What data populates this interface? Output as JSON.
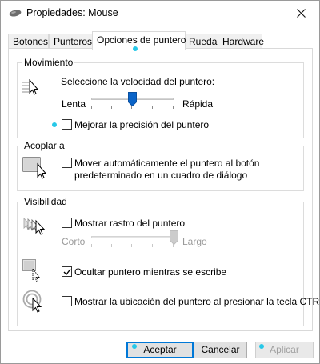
{
  "window": {
    "title": "Propiedades: Mouse"
  },
  "tabs": [
    {
      "label": "Botones"
    },
    {
      "label": "Punteros"
    },
    {
      "label": "Opciones de puntero"
    },
    {
      "label": "Rueda"
    },
    {
      "label": "Hardware"
    }
  ],
  "movement": {
    "group_title": "Movimiento",
    "speed_label": "Seleccione la velocidad del puntero:",
    "slow_label": "Lenta",
    "fast_label": "Rápida",
    "speed_level": 0.5,
    "precision_label": "Mejorar la precisión del puntero",
    "precision_checked": false
  },
  "snap": {
    "group_title": "Acoplar a",
    "line1": "Mover automáticamente el puntero al botón",
    "line2": "predeterminado en un cuadro de diálogo",
    "checked": false
  },
  "visibility": {
    "group_title": "Visibilidad",
    "trails_label": "Mostrar rastro del puntero",
    "trails_checked": false,
    "short_label": "Corto",
    "long_label": "Largo",
    "trails_level": 1.0,
    "hide_label": "Ocultar puntero mientras se escribe",
    "hide_checked": true,
    "ctrl_label": "Mostrar la ubicación del puntero al presionar la tecla CTRL",
    "ctrl_checked": false
  },
  "buttons": {
    "accept": "Aceptar",
    "cancel": "Cancelar",
    "apply": "Aplicar"
  },
  "colors": {
    "highlight_dot": "#27c8e8",
    "focus_border": "#0078d7",
    "slider_thumb": "#0a64c8"
  }
}
